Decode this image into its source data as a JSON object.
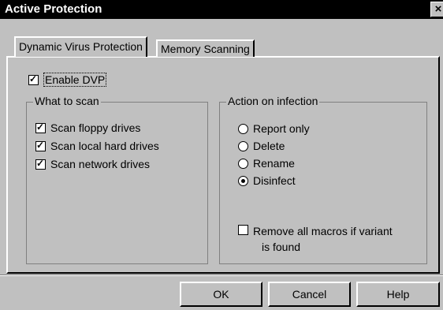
{
  "window": {
    "title": "Active Protection",
    "close_glyph": "×"
  },
  "tabs": [
    {
      "label": "Dynamic Virus Protection",
      "active": true
    },
    {
      "label": "Memory Scanning",
      "active": false
    }
  ],
  "enable_dvp": {
    "label": "Enable DVP",
    "checked": true
  },
  "what_to_scan": {
    "legend": "What to scan",
    "items": [
      {
        "label": "Scan floppy drives",
        "checked": true
      },
      {
        "label": "Scan local hard drives",
        "checked": true
      },
      {
        "label": "Scan network drives",
        "checked": true
      }
    ]
  },
  "action_on_infection": {
    "legend": "Action on infection",
    "options": [
      {
        "label": "Report only",
        "selected": false
      },
      {
        "label": "Delete",
        "selected": false
      },
      {
        "label": "Rename",
        "selected": false
      },
      {
        "label": "Disinfect",
        "selected": true
      }
    ],
    "remove_macros": {
      "line1": "Remove all macros if variant",
      "line2": "is found",
      "checked": false
    }
  },
  "buttons": {
    "ok": "OK",
    "cancel": "Cancel",
    "help": "Help"
  },
  "colors": {
    "dialog_bg": "#c0c0c0",
    "titlebar_bg": "#000000"
  },
  "icons": {
    "check": "check-mark-icon",
    "radio_dot": "radio-dot-icon",
    "close": "close-icon"
  }
}
